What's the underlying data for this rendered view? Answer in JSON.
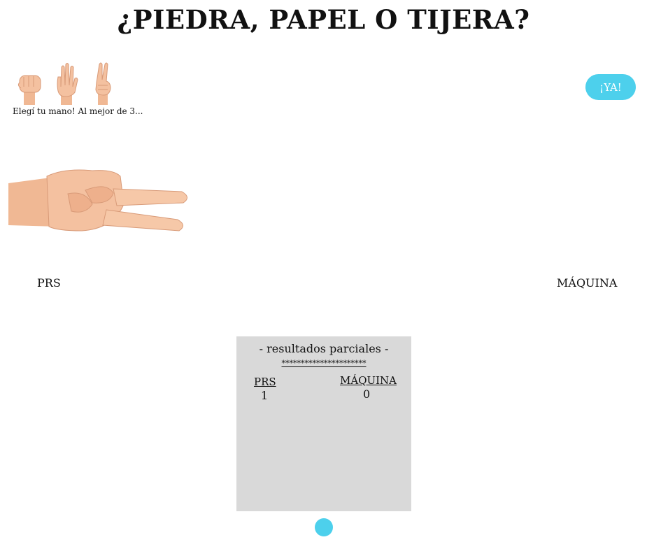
{
  "title": "¿PIEDRA, PAPEL O TIJERA?",
  "hand_options": [
    {
      "icon": "fist-rock-icon"
    },
    {
      "icon": "open-hand-paper-icon"
    },
    {
      "icon": "two-fingers-scissors-icon"
    }
  ],
  "instructions": "Elegí tu mano! Al mejor de 3...",
  "start_button_label": "¡YA!",
  "player_hand_icon": "scissors-hand-icon",
  "labels": {
    "player": "PRS",
    "machine": "MÁQUINA"
  },
  "results": {
    "title": "- resultados parciales -",
    "separator": "**********************",
    "player_header": "PRS",
    "machine_header": "MÁQUINA",
    "player_score": "1",
    "machine_score": "0"
  },
  "colors": {
    "accent": "#4dd0ec",
    "results_bg": "#d9d9d9",
    "skin": "#f0b894"
  }
}
